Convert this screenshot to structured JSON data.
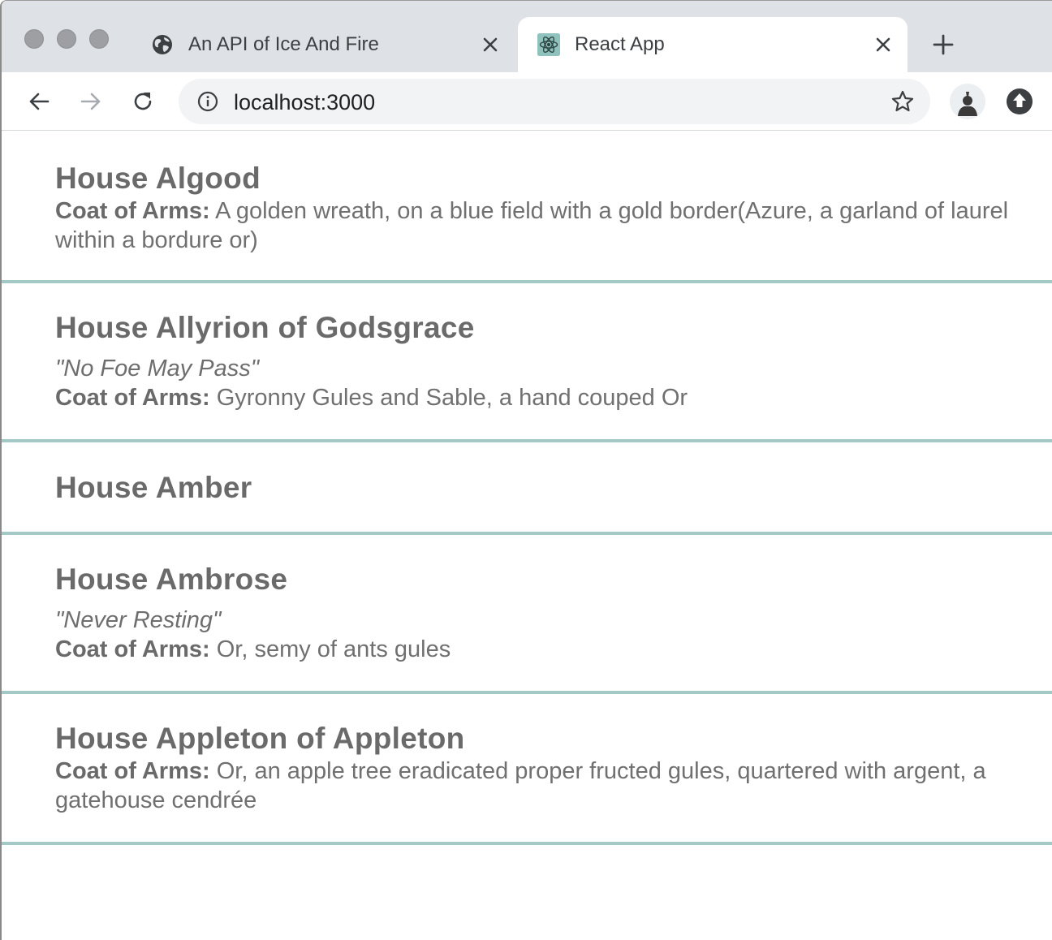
{
  "browser": {
    "tabs": [
      {
        "title": "An API of Ice And Fire",
        "icon": "globe-icon",
        "active": false
      },
      {
        "title": "React App",
        "icon": "react-logo-icon",
        "active": true
      }
    ],
    "address": "localhost:3000"
  },
  "colors": {
    "divider": "#a4c8c5",
    "text": "#6a6a6a",
    "tabstrip": "#dee1e6"
  },
  "houses": [
    {
      "name": "House Algood",
      "words": "",
      "coa_label": "Coat of Arms:",
      "coa": "A golden wreath, on a blue field with a gold border(Azure, a garland of laurel within a bordure or)"
    },
    {
      "name": "House Allyrion of Godsgrace",
      "words": "\"No Foe May Pass\"",
      "coa_label": "Coat of Arms:",
      "coa": "Gyronny Gules and Sable, a hand couped Or"
    },
    {
      "name": "House Amber",
      "words": "",
      "coa_label": "",
      "coa": ""
    },
    {
      "name": "House Ambrose",
      "words": "\"Never Resting\"",
      "coa_label": "Coat of Arms:",
      "coa": "Or, semy of ants gules"
    },
    {
      "name": "House Appleton of Appleton",
      "words": "",
      "coa_label": "Coat of Arms:",
      "coa": "Or, an apple tree eradicated proper fructed gules, quartered with argent, a gatehouse cendrée"
    }
  ]
}
